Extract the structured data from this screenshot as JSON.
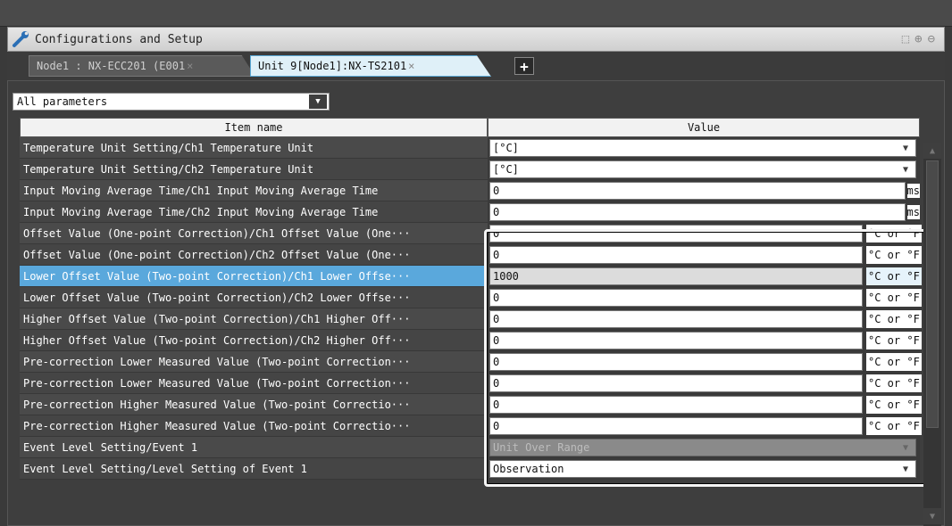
{
  "window": {
    "title": "Configurations and Setup",
    "tools": [
      "fit-icon",
      "zoom-in-icon",
      "zoom-out-icon"
    ]
  },
  "tabs": [
    {
      "label": "Node1 : NX-ECC201 (E001",
      "close": "×",
      "active": false
    },
    {
      "label": "Unit 9[Node1]:NX-TS2101",
      "close": "×",
      "active": true
    }
  ],
  "add_tab_label": "+",
  "filter": {
    "selected": "All parameters"
  },
  "columns": {
    "item_name": "Item name",
    "value": "Value"
  },
  "rows": [
    {
      "name": "Temperature Unit Setting/Ch1 Temperature Unit",
      "value": "[°C]",
      "kind": "select"
    },
    {
      "name": "Temperature Unit Setting/Ch2 Temperature Unit",
      "value": "[°C]",
      "kind": "select"
    },
    {
      "name": "Input Moving Average Time/Ch1 Input Moving Average Time",
      "value": "0",
      "unit": "ms",
      "kind": "ms"
    },
    {
      "name": "Input Moving Average Time/Ch2 Input Moving Average Time",
      "value": "0",
      "unit": "ms",
      "kind": "ms"
    },
    {
      "name": "Offset Value (One-point Correction)/Ch1 Offset Value (One···",
      "value": "0",
      "unit": "°C or °F",
      "kind": "cf"
    },
    {
      "name": "Offset Value (One-point Correction)/Ch2 Offset Value (One···",
      "value": "0",
      "unit": "°C or °F",
      "kind": "cf"
    },
    {
      "name": "Lower Offset Value (Two-point Correction)/Ch1 Lower Offse···",
      "value": "1000",
      "unit": "°C or °F",
      "kind": "cf",
      "selected": true
    },
    {
      "name": "Lower Offset Value (Two-point Correction)/Ch2 Lower Offse···",
      "value": "0",
      "unit": "°C or °F",
      "kind": "cf"
    },
    {
      "name": "Higher Offset Value (Two-point Correction)/Ch1 Higher Off···",
      "value": "0",
      "unit": "°C or °F",
      "kind": "cf"
    },
    {
      "name": "Higher Offset Value (Two-point Correction)/Ch2 Higher Off···",
      "value": "0",
      "unit": "°C or °F",
      "kind": "cf"
    },
    {
      "name": "Pre-correction Lower Measured Value (Two-point Correction···",
      "value": "0",
      "unit": "°C or °F",
      "kind": "cf"
    },
    {
      "name": "Pre-correction Lower Measured Value (Two-point Correction···",
      "value": "0",
      "unit": "°C or °F",
      "kind": "cf"
    },
    {
      "name": "Pre-correction Higher Measured Value (Two-point Correctio···",
      "value": "0",
      "unit": "°C or °F",
      "kind": "cf"
    },
    {
      "name": "Pre-correction Higher Measured Value (Two-point Correctio···",
      "value": "0",
      "unit": "°C or °F",
      "kind": "cf"
    },
    {
      "name": "Event Level Setting/Event 1",
      "value": "Unit Over Range",
      "kind": "dim"
    },
    {
      "name": "Event Level Setting/Level Setting of Event 1",
      "value": "Observation",
      "kind": "select"
    }
  ],
  "colors": {
    "accent": "#5aa8dc",
    "tab_active": "#dff0f8"
  }
}
